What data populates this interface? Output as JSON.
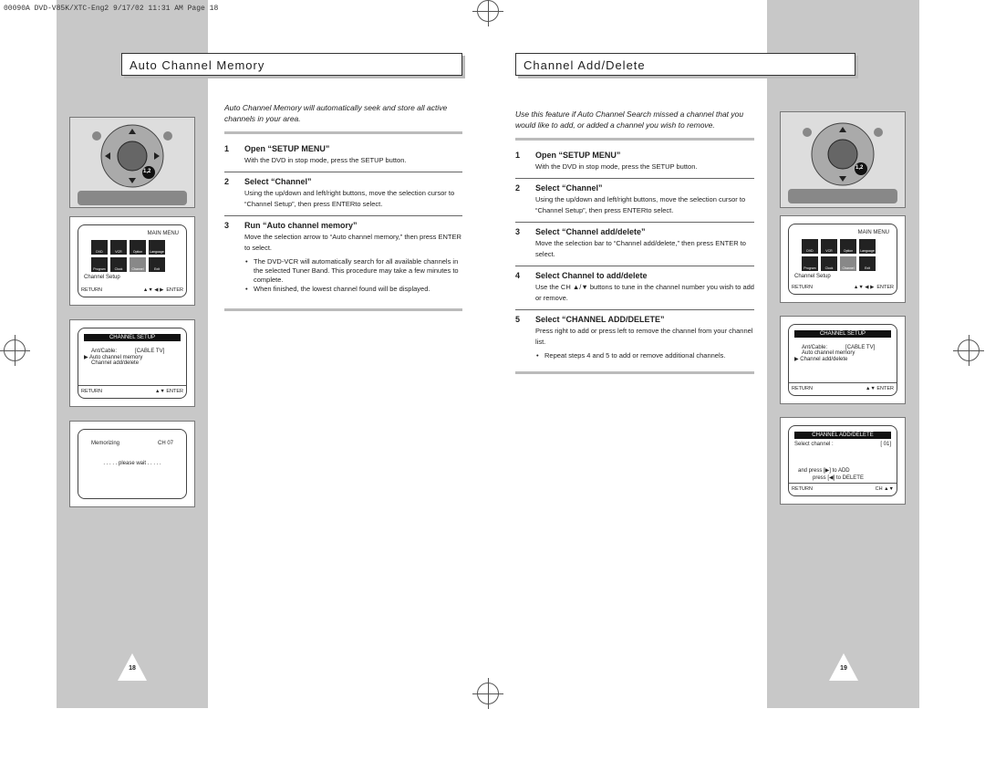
{
  "header": "00090A DVD-V85K/XTC-Eng2  9/17/02 11:31 AM  Page 18",
  "left": {
    "title": "Auto Channel Memory",
    "intro": "Auto Channel Memory will automatically seek and store all active channels in your area.",
    "steps": [
      {
        "n": "1",
        "h": "Open “SETUP MENU”",
        "d": "With the DVD in stop mode, press the SETUP button."
      },
      {
        "n": "2",
        "h": "Select “Channel”",
        "d": "Using the up/down and left/right buttons, move the selection cursor to “Channel Setup”, then press ENTERto select."
      },
      {
        "n": "3",
        "h": "Run “Auto channel memory”",
        "d": "Move the selection arrow to “Auto channel memory,” then press ENTER to select.",
        "bullets": [
          "The DVD-VCR will automatically search for all available channels in the selected Tuner Band. This procedure may take a few minutes to complete.",
          "When finished, the lowest channel found will be displayed."
        ]
      }
    ],
    "page": "18",
    "remote_callout": "1,2",
    "main_menu": {
      "title": "MAIN MENU",
      "items": [
        "DVD",
        "VCR",
        "Option",
        "Language",
        "Program",
        "Clock",
        "Channel",
        "Exit"
      ],
      "caption": "Channel Setup",
      "return": "RETURN",
      "nav": "▲▼ ◀ ▶",
      "enter": "ENTER"
    },
    "channel_setup": {
      "title": "CHANNEL SETUP",
      "ant_label": "Ant/Cable:",
      "ant_value": "[CABLE TV]",
      "item1": "Auto channel memory",
      "item2": "Channel add/delete",
      "return": "RETURN",
      "nav": "▲▼",
      "enter": "ENTER"
    },
    "memorizing": {
      "label": "Memorizing",
      "channel": "CH 07",
      "wait": ". . . . . please wait . . . . ."
    }
  },
  "right": {
    "title": "Channel Add/Delete",
    "intro": "Use this feature if Auto Channel Search missed a channel that you would like to add, or added a channel you wish to remove.",
    "steps": [
      {
        "n": "1",
        "h": "Open “SETUP MENU”",
        "d": "With the DVD in stop mode, press the SETUP button."
      },
      {
        "n": "2",
        "h": "Select “Channel”",
        "d": "Using the up/down and left/right buttons, move the selection cursor to “Channel Setup”, then press ENTERto select."
      },
      {
        "n": "3",
        "h": "Select “Channel add/delete”",
        "d": "Move the selection bar to “Channel add/delete,” then press ENTER to select."
      },
      {
        "n": "4",
        "h": "Select Channel to add/delete",
        "d": "Use the CH ▲/▼ buttons to tune in the channel number you wish to add or remove."
      },
      {
        "n": "5",
        "h": "Select “CHANNEL ADD/DELETE”",
        "d": "Press right to add or press left to remove the channel from your channel list.",
        "bullets": [
          "Repeat steps 4 and 5 to add or remove additional channels."
        ]
      }
    ],
    "page": "19",
    "remote_callout": "1,2",
    "main_menu": {
      "title": "MAIN MENU",
      "items": [
        "DVD",
        "VCR",
        "Option",
        "Language",
        "Program",
        "Clock",
        "Channel",
        "Exit"
      ],
      "caption": "Channel Setup",
      "return": "RETURN",
      "nav": "▲▼ ◀ ▶",
      "enter": "ENTER"
    },
    "channel_setup": {
      "title": "CHANNEL SETUP",
      "ant_label": "Ant/Cable:",
      "ant_value": "[CABLE TV]",
      "item1": "Auto channel memory",
      "item2": "Channel add/delete",
      "return": "RETURN",
      "nav": "▲▼",
      "enter": "ENTER"
    },
    "add_delete": {
      "title": "CHANNEL ADD/DELETE",
      "select_label": "Select channel :",
      "select_value": "[ 01]",
      "add_line": "and  press  [▶]  to   ADD",
      "del_line": "press  [◀]  to   DELETE",
      "return": "RETURN",
      "ch": "CH ▲▼"
    }
  }
}
